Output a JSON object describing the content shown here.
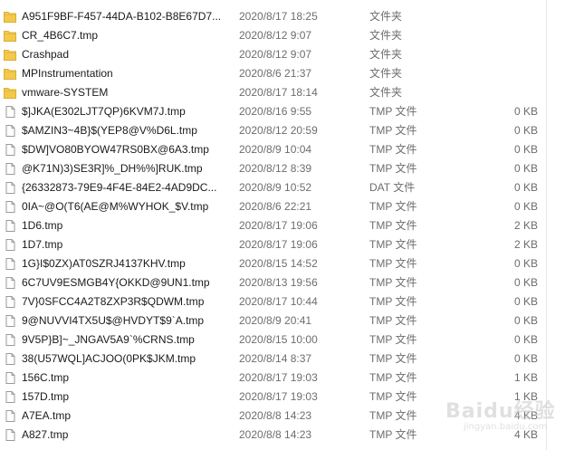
{
  "files": [
    {
      "name": "A951F9BF-F457-44DA-B102-B8E67D7...",
      "date": "2020/8/17 18:25",
      "type": "文件夹",
      "size": "",
      "icon": "folder-icon"
    },
    {
      "name": "CR_4B6C7.tmp",
      "date": "2020/8/12 9:07",
      "type": "文件夹",
      "size": "",
      "icon": "folder-icon"
    },
    {
      "name": "Crashpad",
      "date": "2020/8/12 9:07",
      "type": "文件夹",
      "size": "",
      "icon": "folder-icon"
    },
    {
      "name": "MPInstrumentation",
      "date": "2020/8/6 21:37",
      "type": "文件夹",
      "size": "",
      "icon": "folder-icon"
    },
    {
      "name": "vmware-SYSTEM",
      "date": "2020/8/17 18:14",
      "type": "文件夹",
      "size": "",
      "icon": "folder-icon"
    },
    {
      "name": "$]JKA(E302LJT7QP)6KVM7J.tmp",
      "date": "2020/8/16 9:55",
      "type": "TMP 文件",
      "size": "0 KB",
      "icon": "file-icon"
    },
    {
      "name": "$AMZIN3~4B}$(YEP8@V%D6L.tmp",
      "date": "2020/8/12 20:59",
      "type": "TMP 文件",
      "size": "0 KB",
      "icon": "file-icon"
    },
    {
      "name": "$DW]VO80BYOW47RS0BX@6A3.tmp",
      "date": "2020/8/9 10:04",
      "type": "TMP 文件",
      "size": "0 KB",
      "icon": "file-icon"
    },
    {
      "name": "@K71N)3)SE3R]%_DH%%]RUK.tmp",
      "date": "2020/8/12 8:39",
      "type": "TMP 文件",
      "size": "0 KB",
      "icon": "file-icon"
    },
    {
      "name": "{26332873-79E9-4F4E-84E2-4AD9DC...",
      "date": "2020/8/9 10:52",
      "type": "DAT 文件",
      "size": "0 KB",
      "icon": "file-icon"
    },
    {
      "name": "0IA~@O(T6(AE@M%WYHOK_$V.tmp",
      "date": "2020/8/6 22:21",
      "type": "TMP 文件",
      "size": "0 KB",
      "icon": "file-icon"
    },
    {
      "name": "1D6.tmp",
      "date": "2020/8/17 19:06",
      "type": "TMP 文件",
      "size": "2 KB",
      "icon": "file-icon"
    },
    {
      "name": "1D7.tmp",
      "date": "2020/8/17 19:06",
      "type": "TMP 文件",
      "size": "2 KB",
      "icon": "file-icon"
    },
    {
      "name": "1G}I$0ZX)AT0SZRJ4137KHV.tmp",
      "date": "2020/8/15 14:52",
      "type": "TMP 文件",
      "size": "0 KB",
      "icon": "file-icon"
    },
    {
      "name": "6C7UV9ESMGB4Y{OKKD@9UN1.tmp",
      "date": "2020/8/13 19:56",
      "type": "TMP 文件",
      "size": "0 KB",
      "icon": "file-icon"
    },
    {
      "name": "7V}0SFCC4A2T8ZXP3R$QDWM.tmp",
      "date": "2020/8/17 10:44",
      "type": "TMP 文件",
      "size": "0 KB",
      "icon": "file-icon"
    },
    {
      "name": "9@NUVVI4TX5U$@HVDYT$9`A.tmp",
      "date": "2020/8/9 20:41",
      "type": "TMP 文件",
      "size": "0 KB",
      "icon": "file-icon"
    },
    {
      "name": "9V5P}B]~_JNGAV5A9`%CRNS.tmp",
      "date": "2020/8/15 10:00",
      "type": "TMP 文件",
      "size": "0 KB",
      "icon": "file-icon"
    },
    {
      "name": "38(U57WQL]ACJOO(0PK$JKM.tmp",
      "date": "2020/8/14 8:37",
      "type": "TMP 文件",
      "size": "0 KB",
      "icon": "file-icon"
    },
    {
      "name": "156C.tmp",
      "date": "2020/8/17 19:03",
      "type": "TMP 文件",
      "size": "1 KB",
      "icon": "file-icon"
    },
    {
      "name": "157D.tmp",
      "date": "2020/8/17 19:03",
      "type": "TMP 文件",
      "size": "1 KB",
      "icon": "file-icon"
    },
    {
      "name": "A7EA.tmp",
      "date": "2020/8/8 14:23",
      "type": "TMP 文件",
      "size": "4 KB",
      "icon": "file-icon"
    },
    {
      "name": "A827.tmp",
      "date": "2020/8/8 14:23",
      "type": "TMP 文件",
      "size": "4 KB",
      "icon": "file-icon"
    }
  ],
  "watermark": {
    "brand": "Baidu经验",
    "sub": "jingyan.baidu.com"
  },
  "colors": {
    "folder": "#f2c94c",
    "folder_dark": "#dcae32",
    "file_border": "#9a9a9a",
    "secondary_text": "#6d6d6d"
  }
}
